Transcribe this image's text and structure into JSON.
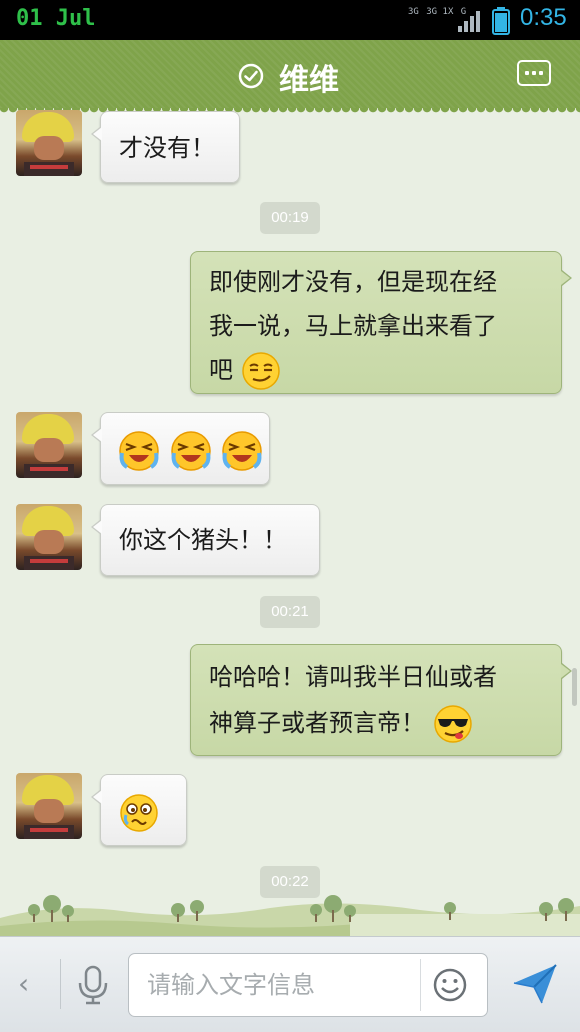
{
  "status_bar": {
    "date": "01 Jul",
    "network_label_1": "3G",
    "network_label_2": "3G 1X",
    "network_label_3": "G",
    "time": "0:35"
  },
  "header": {
    "title": "维维",
    "title_icon": "check-circle-icon",
    "more_icon": "more-icon"
  },
  "messages": [
    {
      "side": "left",
      "text": "才没有！"
    },
    {
      "time": "00:19"
    },
    {
      "side": "right",
      "text_line1": "即使刚才没有，但是现在经",
      "text_line2": "我一说，马上就拿出来看了",
      "text_line3": "吧",
      "emoji": "smirk-emoji"
    },
    {
      "side": "left",
      "emojis": [
        "laugh-tears-emoji",
        "laugh-tears-emoji",
        "laugh-tears-emoji"
      ]
    },
    {
      "side": "left",
      "text": "你这个猪头！！"
    },
    {
      "time": "00:21"
    },
    {
      "side": "right",
      "text_line1": "哈哈哈！请叫我半日仙或者",
      "text_line2": "神算子或者预言帝！",
      "emoji": "sunglasses-emoji"
    },
    {
      "side": "left",
      "emoji": "wronged-emoji"
    },
    {
      "time": "00:22"
    }
  ],
  "input_bar": {
    "back_label": "‹",
    "placeholder": "请输入文字信息"
  },
  "colors": {
    "title_bar": "#7fa34a",
    "chat_background": "#e9efe3",
    "outgoing_bubble": "#cadaa9",
    "incoming_bubble": "#f5f5f5",
    "send_arrow": "#3a8fd8"
  }
}
